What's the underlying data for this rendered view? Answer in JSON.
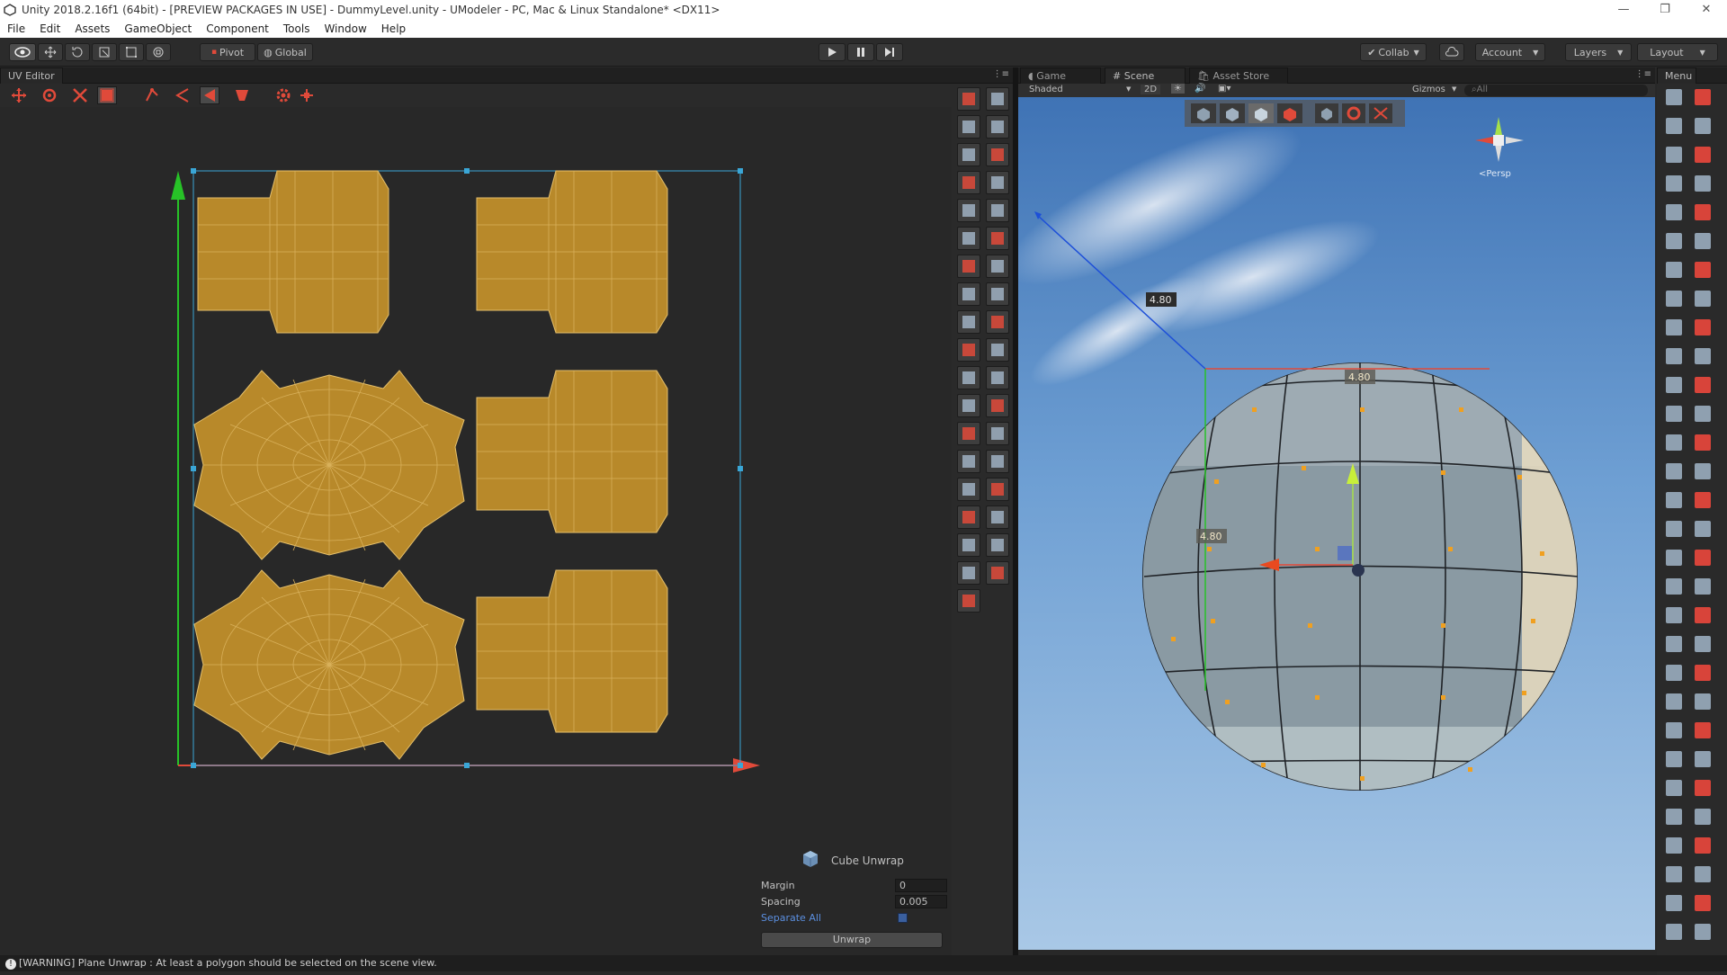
{
  "window": {
    "title": "Unity 2018.2.16f1 (64bit) - [PREVIEW PACKAGES IN USE] - DummyLevel.unity - UModeler - PC, Mac & Linux Standalone* <DX11>",
    "controls": [
      "—",
      "❐",
      "✕"
    ]
  },
  "menu": [
    "File",
    "Edit",
    "Assets",
    "GameObject",
    "Component",
    "Tools",
    "Window",
    "Help"
  ],
  "toolbar": {
    "pivot_label": "Pivot",
    "global_label": "Global",
    "collab_label": "Collab",
    "account_label": "Account",
    "layers_label": "Layers",
    "layout_label": "Layout"
  },
  "uv_editor": {
    "tab_label": "UV Editor"
  },
  "scene_tabs": {
    "game_label": "Game",
    "scene_label": "Scene",
    "asset_store_label": "Asset Store",
    "shaded_label": "Shaded",
    "mode_2d_label": "2D",
    "gizmos_label": "Gizmos",
    "search_placeholder": "All",
    "persp_label": "<Persp"
  },
  "right_menu": {
    "tab_label": "Menu"
  },
  "measure": {
    "diagonal": "4.80",
    "width": "4.80",
    "height": "4.80"
  },
  "cube_unwrap": {
    "title": "Cube Unwrap",
    "margin_label": "Margin",
    "margin_value": "0",
    "spacing_label": "Spacing",
    "spacing_value": "0.005",
    "separate_label": "Separate All",
    "unwrap_button": "Unwrap"
  },
  "status": {
    "message": "[WARNING] Plane Unwrap : At least a polygon should be selected on the scene view."
  },
  "colors": {
    "uv_fill": "#b8892a",
    "uv_line": "#e6c06b",
    "accent_red": "#e04a3a",
    "selection": "#3aa6d6"
  }
}
